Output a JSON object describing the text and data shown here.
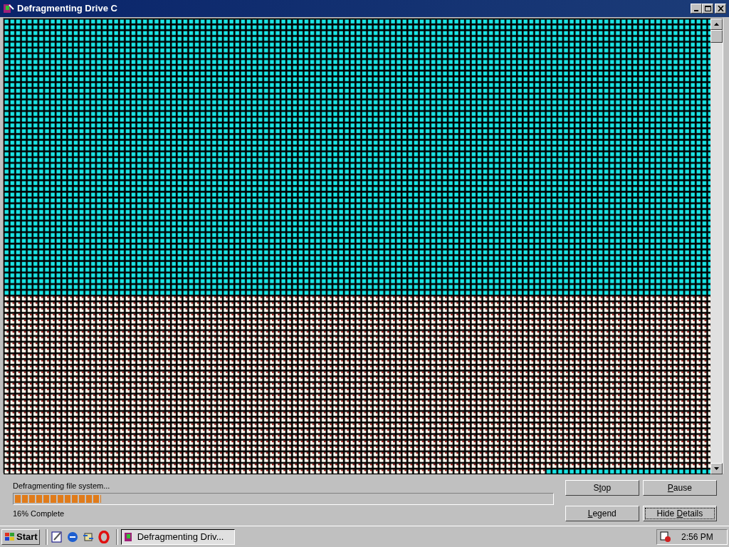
{
  "window": {
    "title": "Defragmenting Drive C"
  },
  "status": {
    "message": "Defragmenting file system...",
    "level": 0.16,
    "reading": "16% Complete"
  },
  "buttons": [
    {
      "parts": [
        {
          "text": "S",
          "underlined": false
        },
        {
          "text": "t",
          "underlined": true
        },
        {
          "text": "op",
          "underlined": false
        }
      ],
      "focused": false
    },
    {
      "parts": [
        {
          "text": "P",
          "underlined": true
        },
        {
          "text": "ause",
          "underlined": false
        }
      ],
      "focused": false
    },
    {
      "parts": [
        {
          "text": "L",
          "underlined": true
        },
        {
          "text": "egend",
          "underlined": false
        }
      ],
      "focused": false
    },
    {
      "parts": [
        {
          "text": "Hide ",
          "underlined": false
        },
        {
          "text": "D",
          "underlined": true
        },
        {
          "text": "etails",
          "underlined": false
        }
      ],
      "focused": true
    }
  ],
  "taskbar": {
    "start": "Start",
    "tasks": [
      {
        "label": "Defragmenting Driv...",
        "selected": true
      }
    ],
    "clock": "2:56 PM"
  }
}
